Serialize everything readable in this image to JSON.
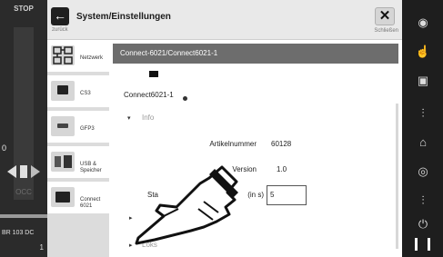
{
  "left_panel": {
    "stop_label": "STOP",
    "speed_value": "0",
    "occ_label": "OCC",
    "loco_name": "BR 103 DC",
    "loco_number": "1"
  },
  "header": {
    "back_label": "zurück",
    "title": "System/Einstellungen",
    "close_glyph": "✕",
    "close_label": "Schließen"
  },
  "categories": [
    {
      "label": "Netzwerk",
      "icon": "network-icon"
    },
    {
      "label": "CS3",
      "icon": "cs3-icon"
    },
    {
      "label": "GFP3",
      "icon": "gfp3-icon"
    },
    {
      "label": "USB & Speicher",
      "icon": "usb-storage-icon"
    },
    {
      "label": "Connect 6021",
      "icon": "connect-6021-icon"
    }
  ],
  "main": {
    "header_title": "Connect-6021/Connect6021-1",
    "device_name": "Connect6021-1",
    "info_toggle": "▾",
    "info_label": "Info",
    "article_label": "Artikelnummer",
    "article_value": "60128",
    "version_label": "Version",
    "version_value": "1.0",
    "setting_label_left": "Sta",
    "setting_label_right": "(in s)",
    "setting_value": "5",
    "collapsed_toggle": "▸",
    "locos_toggle": "▸",
    "locos_label": "Loks"
  },
  "right_panel": {
    "icons": [
      "lamp-icon",
      "hand-icon",
      "lock-icon",
      "function-icon",
      "home-icon",
      "sound-icon",
      "function-2-icon",
      "power-icon"
    ]
  },
  "colors": {
    "dark_strip": "#2b2b2b",
    "section_header": "#6d6d6d",
    "sidebar_bg": "#dcdcdc"
  }
}
